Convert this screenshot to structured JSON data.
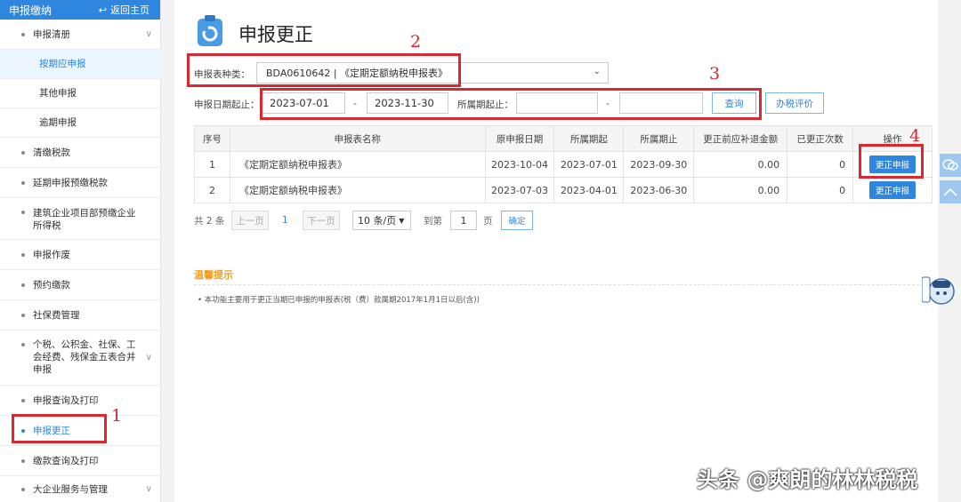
{
  "sidebar": {
    "header": {
      "title": "申报缴纳",
      "back_label": "返回主页"
    },
    "items": [
      {
        "label": "申报清册"
      },
      {
        "label": "按期应申报"
      },
      {
        "label": "其他申报"
      },
      {
        "label": "逾期申报"
      },
      {
        "label": "清缴税款"
      },
      {
        "label": "延期申报预缴税款"
      },
      {
        "label": "建筑企业项目部预缴企业所得税"
      },
      {
        "label": "申报作废"
      },
      {
        "label": "预约缴款"
      },
      {
        "label": "社保费管理"
      },
      {
        "label": "个税、公积金、社保、工会经费、残保金五表合并申报"
      },
      {
        "label": "申报查询及打印"
      },
      {
        "label": "申报更正"
      },
      {
        "label": "缴款查询及打印"
      },
      {
        "label": "大企业服务与管理"
      }
    ]
  },
  "page": {
    "title": "申报更正"
  },
  "form": {
    "type_label": "申报表种类：",
    "type_value": "BDA0610642 | 《定期定额纳税申报表》",
    "date_label": "申报日期起止：",
    "date_from": "2023-07-01",
    "date_to": "2023-11-30",
    "period_label": "所属期起止：",
    "period_from": "",
    "period_to": "",
    "dash": "-",
    "query_label": "查询",
    "rate_label": "办税评价"
  },
  "table": {
    "headers": [
      "序号",
      "申报表名称",
      "原申报日期",
      "所属期起",
      "所属期止",
      "更正前应补退金额",
      "已更正次数",
      "操作"
    ],
    "rows": [
      {
        "no": "1",
        "name": "《定期定额纳税申报表》",
        "orig_date": "2023-10-04",
        "from": "2023-07-01",
        "to": "2023-09-30",
        "amount": "0.00",
        "count": "0",
        "action": "更正申报"
      },
      {
        "no": "2",
        "name": "《定期定额纳税申报表》",
        "orig_date": "2023-07-03",
        "from": "2023-04-01",
        "to": "2023-06-30",
        "amount": "0.00",
        "count": "0",
        "action": "更正申报"
      }
    ]
  },
  "pagination": {
    "total": "共 2 条",
    "prev": "上一页",
    "current": "1",
    "next": "下一页",
    "per_page": "10 条/页",
    "goto_label": "到第",
    "goto_value": "1",
    "page_suffix": "页",
    "confirm": "确定"
  },
  "tips": {
    "title": "温馨提示",
    "text": "本功能主要用于更正当期已申报的申报表(税（费）款属期2017年1月1日以后(含))"
  },
  "annotations": [
    "1",
    "2",
    "3",
    "4"
  ],
  "watermark": "头条 @爽朗的林林税税",
  "colors": {
    "accent": "#2e86de",
    "annotation": "#d9282f",
    "tip": "#f29b1a"
  }
}
